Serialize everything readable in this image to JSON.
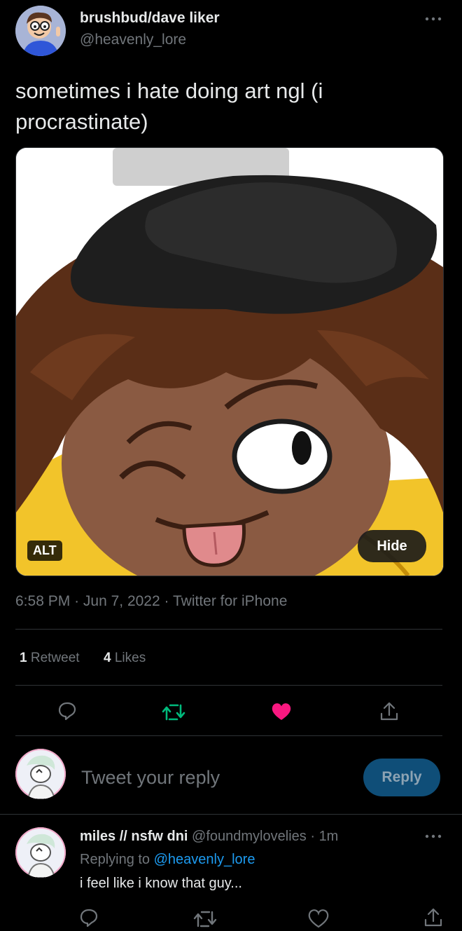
{
  "tweet": {
    "author_name": "brushbud/dave liker",
    "author_handle": "@heavenly_lore",
    "text": "sometimes i hate doing art ngl (i procrastinate)",
    "media": {
      "alt_badge": "ALT",
      "hide_label": "Hide"
    },
    "time": "6:58 PM",
    "date": "Jun 7, 2022",
    "source": "Twitter for iPhone",
    "separator": "·",
    "retweet_count": "1",
    "retweet_label": "Retweet",
    "like_count": "4",
    "like_label": "Likes"
  },
  "composer": {
    "placeholder": "Tweet your reply",
    "reply_button": "Reply"
  },
  "reply": {
    "author_name": "miles // nsfw dni",
    "author_handle": "@foundmylovelies",
    "separator": "·",
    "time": "1m",
    "replying_to_label": "Replying to",
    "replying_to_handle": "@heavenly_lore",
    "text": "i feel like i know that guy..."
  },
  "colors": {
    "background": "#000000",
    "text": "#e7e9ea",
    "muted": "#71767b",
    "link": "#1d9bf0",
    "retweet_green": "#00ba7c",
    "like_pink": "#f91880",
    "reply_button_bg": "#0f4e78"
  },
  "icons": {
    "more": "more-horizontal-icon",
    "reply": "reply-bubble-icon",
    "retweet": "retweet-icon",
    "like": "heart-icon",
    "share": "share-icon"
  }
}
